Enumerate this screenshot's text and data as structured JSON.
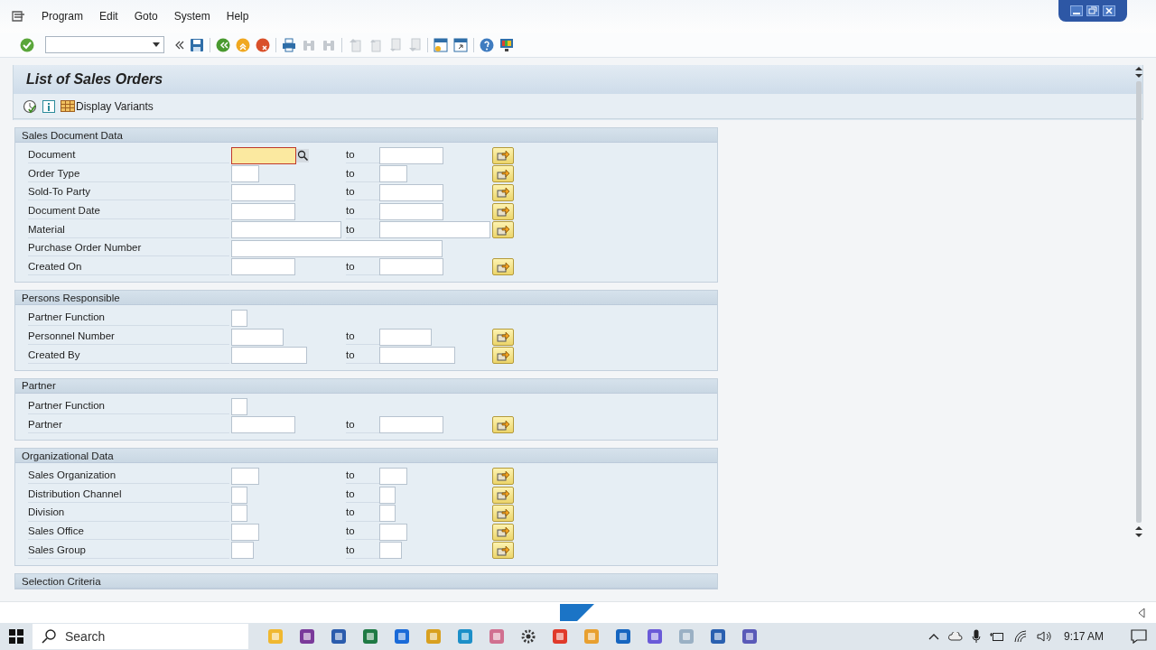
{
  "menu": [
    "Program",
    "Edit",
    "Goto",
    "System",
    "Help"
  ],
  "title": "List of Sales Orders",
  "app_toolbar": {
    "display_variants": "Display Variants"
  },
  "sections": [
    {
      "title": "Sales Document Data",
      "rows": [
        {
          "label": "Document",
          "kind": "range",
          "focused": true,
          "to": "to"
        },
        {
          "label": "Order Type",
          "kind": "range",
          "focused": false,
          "to": "to"
        },
        {
          "label": "Sold-To Party",
          "kind": "range",
          "focused": false,
          "to": "to"
        },
        {
          "label": "Document Date",
          "kind": "range",
          "focused": false,
          "to": "to"
        },
        {
          "label": "Material",
          "kind": "range",
          "focused": false,
          "to": "to"
        },
        {
          "label": "Purchase Order Number",
          "kind": "single",
          "focused": false
        },
        {
          "label": "Created On",
          "kind": "range",
          "focused": false,
          "to": "to"
        }
      ]
    },
    {
      "title": "Persons Responsible",
      "rows": [
        {
          "label": "Partner Function",
          "kind": "single",
          "focused": false
        },
        {
          "label": "Personnel Number",
          "kind": "range",
          "focused": false,
          "to": "to"
        },
        {
          "label": "Created By",
          "kind": "range",
          "focused": false,
          "to": "to"
        }
      ]
    },
    {
      "title": "Partner",
      "rows": [
        {
          "label": "Partner Function",
          "kind": "single",
          "focused": false
        },
        {
          "label": "Partner",
          "kind": "range",
          "focused": false,
          "to": "to"
        }
      ]
    },
    {
      "title": "Organizational Data",
      "rows": [
        {
          "label": "Sales Organization",
          "kind": "range",
          "focused": false,
          "to": "to"
        },
        {
          "label": "Distribution Channel",
          "kind": "range",
          "focused": false,
          "to": "to"
        },
        {
          "label": "Division",
          "kind": "range",
          "focused": false,
          "to": "to"
        },
        {
          "label": "Sales Office",
          "kind": "range",
          "focused": false,
          "to": "to"
        },
        {
          "label": "Sales Group",
          "kind": "range",
          "focused": false,
          "to": "to"
        }
      ]
    },
    {
      "title": "Selection Criteria"
    }
  ],
  "taskbar": {
    "search_placeholder": "Search",
    "time": "9:17 AM"
  }
}
